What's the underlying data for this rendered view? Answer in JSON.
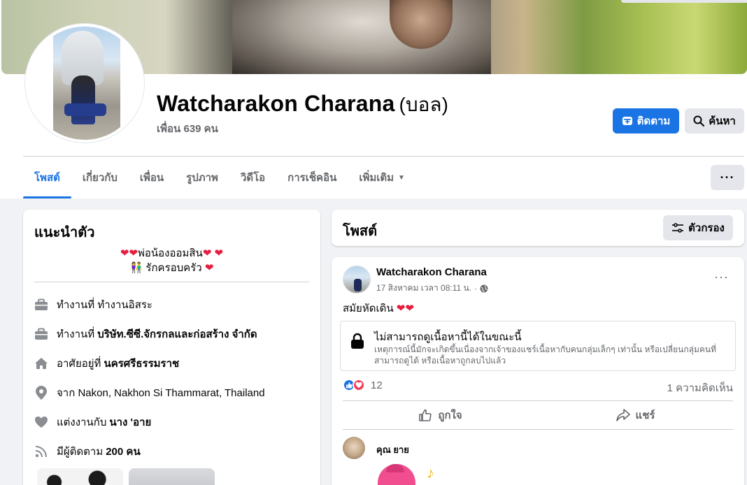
{
  "profile": {
    "name": "Watcharakon Charana",
    "nickname": "(บอล)",
    "friends": "เพื่อน 639 คน"
  },
  "actions": {
    "follow": "ติดตาม",
    "search": "ค้นหา",
    "more": "···"
  },
  "tabs": [
    {
      "label": "โพสต์",
      "active": true
    },
    {
      "label": "เกี่ยวกับ"
    },
    {
      "label": "เพื่อน"
    },
    {
      "label": "รูปภาพ"
    },
    {
      "label": "วิดีโอ"
    },
    {
      "label": "การเช็คอิน"
    },
    {
      "label": "เพิ่มเติม"
    }
  ],
  "intro": {
    "title": "แนะนำตัว",
    "bio_line1": "พ่อน้องออมสิน",
    "bio_line2": "รักครอบครัว",
    "work1_prefix": "ทำงานที่",
    "work1_place": "ทำงานอิสระ",
    "work2_prefix": "ทำงานที่",
    "work2_place": "บริษัท.ซีซี.จักรกลและก่อสร้าง จำกัด",
    "lives_prefix": "อาศัยอยู่ที่",
    "lives_place": "นครศรีธรรมราช",
    "from_prefix": "จาก",
    "from_place": "Nakon, Nakhon Si Thammarat, Thailand",
    "married_prefix": "แต่งงานกับ",
    "married_name": "นาง 'อาย",
    "followers_prefix": "มีผู้ติดตาม",
    "followers_count": "200 คน"
  },
  "posts": {
    "title": "โพสต์",
    "filter": "ตัวกรอง"
  },
  "post": {
    "author": "Watcharakon Charana",
    "timestamp": "17 สิงหาคม เวลา 08:11 น.",
    "dot": "·",
    "text": "สมัยหัดเดิน",
    "unavailable_title": "ไม่สามารถดูเนื้อหานี้ได้ในขณะนี้",
    "unavailable_body": "เหตุการณ์นี้มักจะเกิดขึ้นเนื่องจากเจ้าของแชร์เนื้อหากับคนกลุ่มเล็กๆ เท่านั้น หรือเปลี่ยนกลุ่มคนที่สามารถดูได้ หรือเนื้อหาถูกลบไปแล้ว",
    "reaction_count": "12",
    "comment_count": "1 ความคิดเห็น",
    "like_label": "ถูกใจ",
    "share_label": "แชร์",
    "commenter": "คุณ ยาย"
  },
  "colors": {
    "accent": "#1b74e4",
    "heart": "#e41e3f",
    "love": "#f33e58"
  }
}
